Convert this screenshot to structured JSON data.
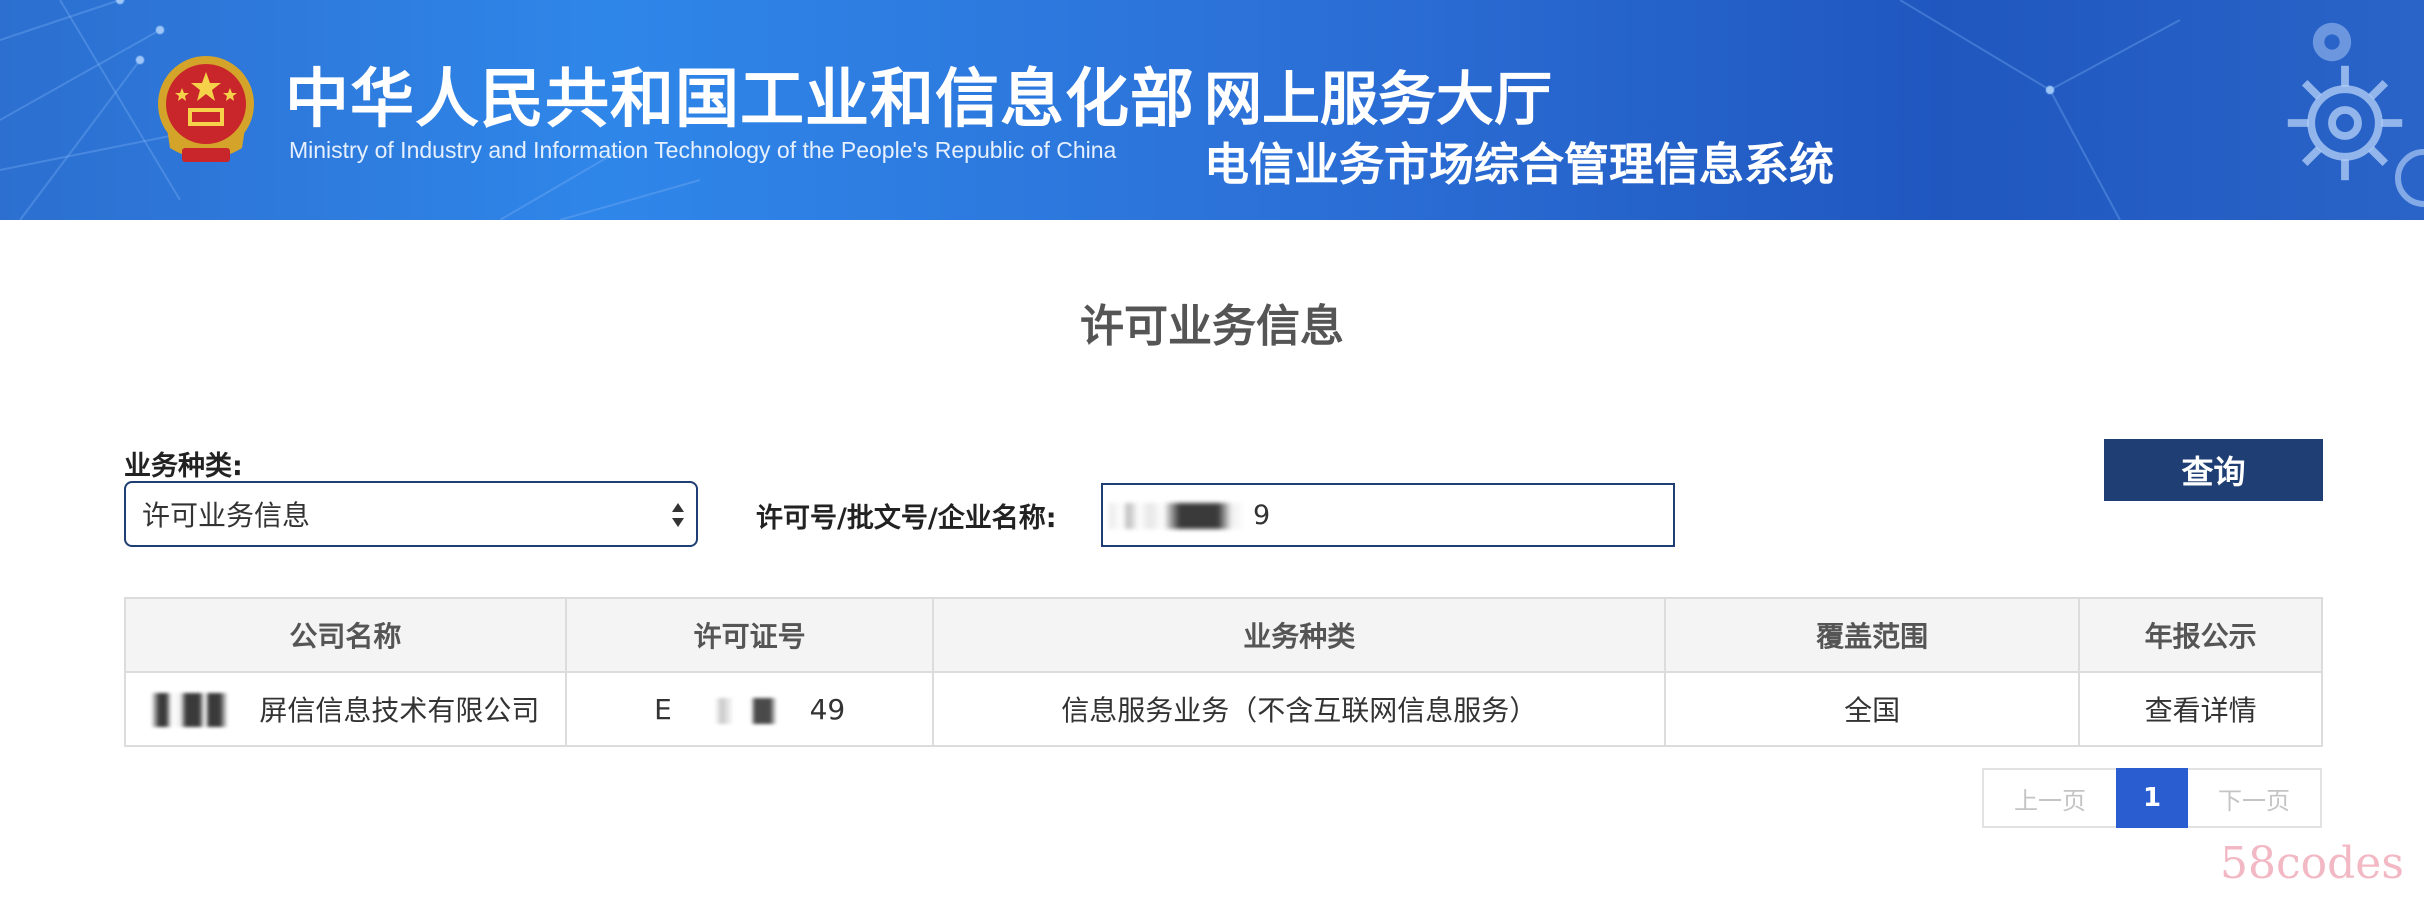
{
  "header": {
    "ministry_cn": "中华人民共和国工业和信息化部",
    "ministry_en": "Ministry of Industry and Information Technology of the People's Republic of China",
    "hall_title": "网上服务大厅",
    "system_title": "电信业务市场综合管理信息系统",
    "emblem_icon": "national-emblem-icon",
    "decor_icon": "gear-icon"
  },
  "page": {
    "title": "许可业务信息"
  },
  "form": {
    "category_label": "业务种类:",
    "category_selected": "许可业务信息",
    "license_label": "许可号/批文号/企业名称:",
    "search_value_visible": "9",
    "query_button": "查询"
  },
  "table": {
    "headers": [
      "公司名称",
      "许可证号",
      "业务种类",
      "覆盖范围",
      "年报公示"
    ],
    "rows": [
      {
        "company_visible": "屏信信息技术有限公司",
        "license_prefix": "E",
        "license_suffix": "49",
        "category": "信息服务业务（不含互联网信息服务）",
        "coverage": "全国",
        "report": "查看详情"
      }
    ]
  },
  "pagination": {
    "prev": "上一页",
    "current": "1",
    "next": "下一页"
  },
  "watermark": "58codes",
  "colors": {
    "banner": "#2b6fd6",
    "accent_navy": "#1f3e73",
    "page_active": "#2a5ed0"
  }
}
